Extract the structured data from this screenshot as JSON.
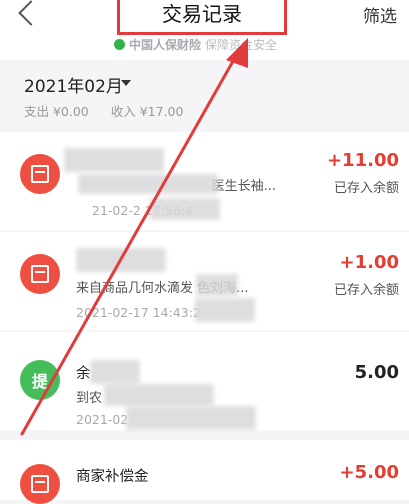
{
  "header": {
    "title": "交易记录",
    "filter_label": "筛选",
    "secure_prefix": "中国人保财险",
    "secure_suffix": "保障资金安全"
  },
  "month": {
    "label": "2021年02月",
    "expense": "支出 ¥0.00",
    "income": "收入 ¥17.00"
  },
  "transactions": [
    {
      "title": "",
      "subtitle": "医生长袖...",
      "time": "21-02-2  17:56:4",
      "amount": "+11.00",
      "status": "已存入余额"
    },
    {
      "title": "",
      "subtitle": "来自商品几何水滴发    色刘海...",
      "time": "2021-02-17 14:43:2",
      "amount": "+1.00",
      "status": "已存入余额"
    },
    {
      "avatar_text": "提",
      "title": "余",
      "subtitle": "到农",
      "time": "2021-02",
      "amount": "5.00",
      "status": ""
    },
    {
      "title": "商家补偿金",
      "amount": "+5.00"
    }
  ],
  "colors": {
    "accent_red": "#e53d31",
    "avatar_red": "#ef4f41",
    "avatar_green": "#45bd5a",
    "highlight_border": "#e23b3b",
    "secure_green": "#34b24a"
  }
}
